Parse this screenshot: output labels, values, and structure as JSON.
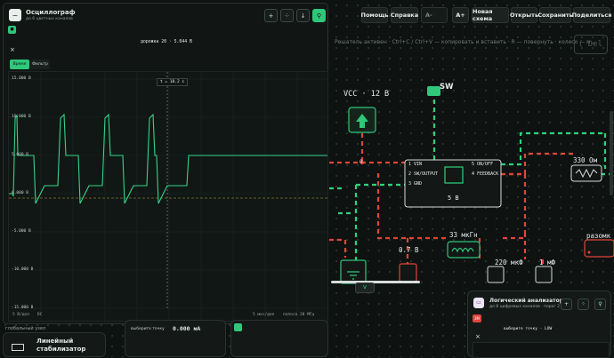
{
  "toolbar": {
    "help": "Помощь",
    "reference": "Справка",
    "font_decrease": "A-",
    "font_increase": "A+",
    "new_scheme": "Новая схема",
    "open": "Открыть",
    "save": "Сохранить",
    "share": "Поделиться"
  },
  "hint": "Решатель активен · Ctrl+C / Ctrl+V — копировать и вставить · R — повернуть · колесо — м...",
  "delete_key": "Del",
  "oscilloscope": {
    "title": "Осциллограф",
    "subtitle": "до 6 цветных каналов",
    "channel_label": "дорожка 20 · 5.044 В",
    "close": "×",
    "tabs": [
      "Время",
      "Фильтр"
    ],
    "cursor_readout": "t = 18.2 s",
    "y_ticks": [
      "15.000 В",
      "10.000 В",
      "5.000 В",
      "0.000 В",
      "-5.000 В",
      "-10.000 В",
      "-15.000 В"
    ],
    "bottom_left": "5 В/дел",
    "coupling": "DC",
    "timebase": "5 мкс/дел",
    "bandwidth": "полоса 20 МГц"
  },
  "circuit": {
    "vcc": "VCC · 12 В",
    "switch": "SW",
    "node_zero": "0",
    "ic_pins": [
      "1 VIN",
      "2 SW/OUTPUT",
      "3 GND",
      "5 ON/OFF",
      "4 FEEDBACK"
    ],
    "ic_value": "5 В",
    "resistor": "330 Ом",
    "inductor": "33 мкГн",
    "diode_v": "0.7 В",
    "cap1": "220 мкФ",
    "cap2": "1 мФ",
    "open_switch": "разомк"
  },
  "bottom": {
    "local_node": "глобальный узел",
    "regulator": "Линейный стабилизатор",
    "probe_label": "выберите точку",
    "probe_value": "0.000 мА"
  },
  "analyzer": {
    "title": "Логический анализатор",
    "subtitle": "до 8 цифровых каналов · порог 2 В",
    "close": "×",
    "probe_label": "выберите точку · LOW"
  },
  "colors": {
    "accent": "#2fc77a",
    "wire_red": "#e0453a",
    "wire_green": "#2ed27b"
  }
}
